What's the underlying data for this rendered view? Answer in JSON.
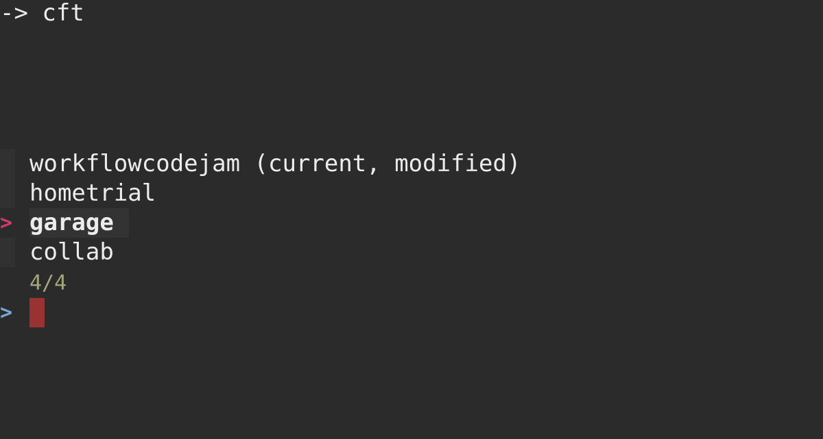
{
  "terminal": {
    "command": "-> cft",
    "items": [
      {
        "label": "workflowcodejam (current, modified)",
        "selected": false
      },
      {
        "label": "hometrial",
        "selected": false
      },
      {
        "label": "garage",
        "selected": true
      },
      {
        "label": "collab",
        "selected": false
      }
    ],
    "selected_marker": ">",
    "match_count": "4/4",
    "prompt_marker": ">",
    "query": ""
  }
}
